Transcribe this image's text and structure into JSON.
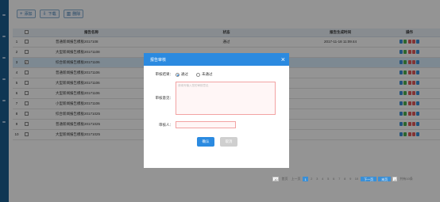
{
  "toolbar": {
    "add_label": "添加",
    "download_label": "下载",
    "delete_label": "删除"
  },
  "table": {
    "headers": [
      "报告名称",
      "状态",
      "报告生成时间",
      "操作"
    ],
    "rows": [
      {
        "idx": "1",
        "name": "普通新闻报告模板2017108",
        "status": "通过",
        "time": "2017-11-18 11:09:44",
        "selected": false
      },
      {
        "idx": "2",
        "name": "大型新闻报告模板20171108",
        "status": "",
        "time": "",
        "selected": false
      },
      {
        "idx": "3",
        "name": "综合新闻报告模板20171106",
        "status": "",
        "time": "",
        "selected": true
      },
      {
        "idx": "4",
        "name": "普通新闻报告模板20171106",
        "status": "",
        "time": "",
        "selected": false
      },
      {
        "idx": "5",
        "name": "大型新闻报告模板20171106",
        "status": "",
        "time": "",
        "selected": false
      },
      {
        "idx": "6",
        "name": "大型新闻报告模板20171106",
        "status": "",
        "time": "",
        "selected": false
      },
      {
        "idx": "7",
        "name": "小型新闻报告模板20171106",
        "status": "",
        "time": "",
        "selected": false
      },
      {
        "idx": "8",
        "name": "综合新闻报告模板20171025",
        "status": "",
        "time": "",
        "selected": false
      },
      {
        "idx": "9",
        "name": "普通新闻报告模板20171025",
        "status": "",
        "time": "",
        "selected": false
      },
      {
        "idx": "10",
        "name": "大型新闻报告模板20171025",
        "status": "",
        "time": "",
        "selected": false
      }
    ],
    "op_colors": [
      "#3a8fd6",
      "#4caf50",
      "#e05a5a",
      "#e05a5a",
      "#3a8fd6"
    ]
  },
  "pager": {
    "page_size": "10",
    "first_label": "首页",
    "prev_label": "上一页",
    "pages": [
      "1",
      "2",
      "3",
      "4",
      "5",
      "6",
      "7",
      "8",
      "9",
      "10"
    ],
    "current": "1",
    "next_label": "下一页",
    "last_label": "末页",
    "jump_value": "1",
    "total_text": "共有10条"
  },
  "dialog": {
    "title": "报告审核",
    "result_label": "审核结果：",
    "option_pass": "通过",
    "option_fail": "未通过",
    "opinion_label": "审核意见：",
    "opinion_placeholder": "请填写输入您的审核意见",
    "reviewer_label": "审核人：",
    "confirm_label": "确认",
    "cancel_label": "取消"
  },
  "colors": {
    "primary": "#2b8ae0",
    "sidebar": "#1b5d8f",
    "error_border": "#f2a3a3"
  }
}
